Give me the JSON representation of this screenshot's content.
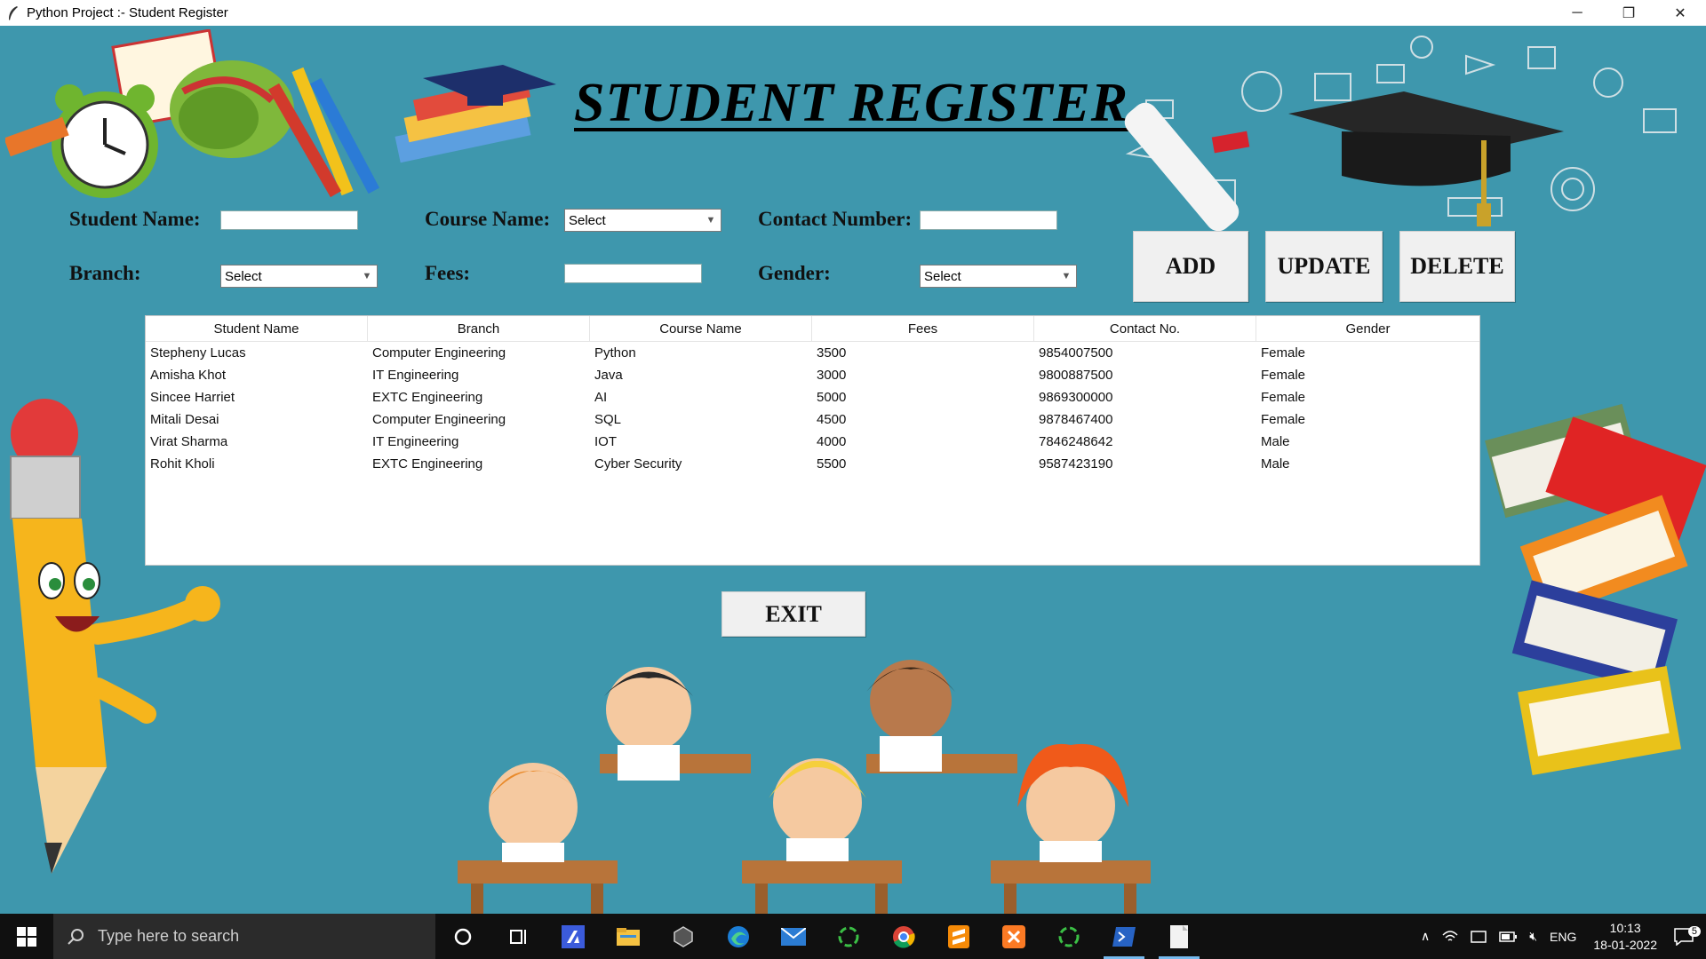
{
  "window": {
    "title": "Python Project :- Student Register",
    "controls": {
      "minimize": "─",
      "restore": "❐",
      "close": "✕"
    }
  },
  "app": {
    "heading": "STUDENT REGISTER",
    "form": {
      "student_name_label": "Student Name:",
      "student_name_value": "",
      "course_name_label": "Course Name:",
      "course_name_value": "Select",
      "contact_number_label": "Contact Number:",
      "contact_number_value": "",
      "branch_label": "Branch:",
      "branch_value": "Select",
      "fees_label": "Fees:",
      "fees_value": "",
      "gender_label": "Gender:",
      "gender_value": "Select"
    },
    "buttons": {
      "add": "ADD",
      "update": "UPDATE",
      "delete": "DELETE",
      "exit": "EXIT"
    },
    "table": {
      "columns": [
        "Student Name",
        "Branch",
        "Course Name",
        "Fees",
        "Contact No.",
        "Gender"
      ],
      "rows": [
        [
          "Stepheny Lucas",
          "Computer Engineering",
          "Python",
          "3500",
          "9854007500",
          "Female"
        ],
        [
          "Amisha Khot",
          "IT Engineering",
          "Java",
          "3000",
          "9800887500",
          "Female"
        ],
        [
          "Sincee Harriet",
          "EXTC Engineering",
          "AI",
          "5000",
          "9869300000",
          "Female"
        ],
        [
          "Mitali Desai",
          "Computer Engineering",
          "SQL",
          "4500",
          "9878467400",
          "Female"
        ],
        [
          "Virat Sharma",
          "IT Engineering",
          "IOT",
          "4000",
          "7846248642",
          "Male"
        ],
        [
          "Rohit Kholi",
          "EXTC Engineering",
          "Cyber Security",
          "5500",
          "9587423190",
          "Male"
        ]
      ]
    },
    "colors": {
      "background": "#3e97ad",
      "button": "#f0f0f0"
    }
  },
  "taskbar": {
    "search_placeholder": "Type here to search",
    "apps": [
      "cortana-icon",
      "task-view-icon",
      "visual-studio-icon",
      "file-explorer-icon",
      "unity-icon",
      "edge-icon",
      "mail-icon",
      "loader-icon",
      "chrome-icon",
      "sublime-text-icon",
      "xampp-icon",
      "loader-icon",
      "powershell-icon",
      "notepad-icon"
    ],
    "language": "ENG",
    "time": "10:13",
    "date": "18-01-2022",
    "notification_count": "5"
  }
}
